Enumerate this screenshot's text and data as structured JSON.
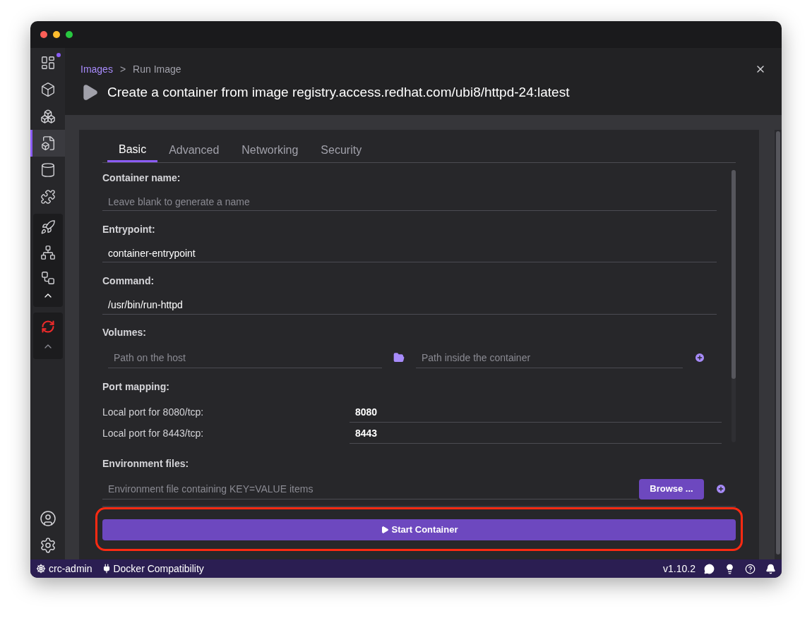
{
  "sidebar": {
    "items": [
      {
        "kind": "dashboard",
        "selected": false,
        "badge": true
      },
      {
        "kind": "containers",
        "selected": false,
        "badge": false
      },
      {
        "kind": "pods",
        "selected": false,
        "badge": false
      },
      {
        "kind": "images",
        "selected": true,
        "badge": false
      },
      {
        "kind": "volumes",
        "selected": false,
        "badge": false
      },
      {
        "kind": "extensions",
        "selected": false,
        "badge": false
      }
    ]
  },
  "header": {
    "breadcrumb": {
      "link": "Images",
      "separator": ">",
      "current": "Run Image"
    },
    "title": "Create a container from image registry.access.redhat.com/ubi8/httpd-24:latest"
  },
  "tabs": [
    {
      "label": "Basic",
      "selected": true
    },
    {
      "label": "Advanced",
      "selected": false
    },
    {
      "label": "Networking",
      "selected": false
    },
    {
      "label": "Security",
      "selected": false
    }
  ],
  "form": {
    "container_name": {
      "label": "Container name:",
      "placeholder": "Leave blank to generate a name"
    },
    "entrypoint": {
      "label": "Entrypoint:",
      "value": "container-entrypoint"
    },
    "command": {
      "label": "Command:",
      "value": "/usr/bin/run-httpd"
    },
    "volumes": {
      "label": "Volumes:",
      "host_placeholder": "Path on the host",
      "container_placeholder": "Path inside the container"
    },
    "port_mapping": {
      "label": "Port mapping:",
      "ports": [
        {
          "label": "Local port for 8080/tcp:",
          "value": "8080"
        },
        {
          "label": "Local port for 8443/tcp:",
          "value": "8443"
        }
      ]
    },
    "environment_files": {
      "label": "Environment files:",
      "placeholder": "Environment file containing KEY=VALUE items",
      "browse_button": "Browse ..."
    },
    "start_button": "Start Container"
  },
  "status_bar": {
    "user": "crc-admin",
    "compatibility": "Docker Compatibility",
    "version": "v1.10.2"
  }
}
